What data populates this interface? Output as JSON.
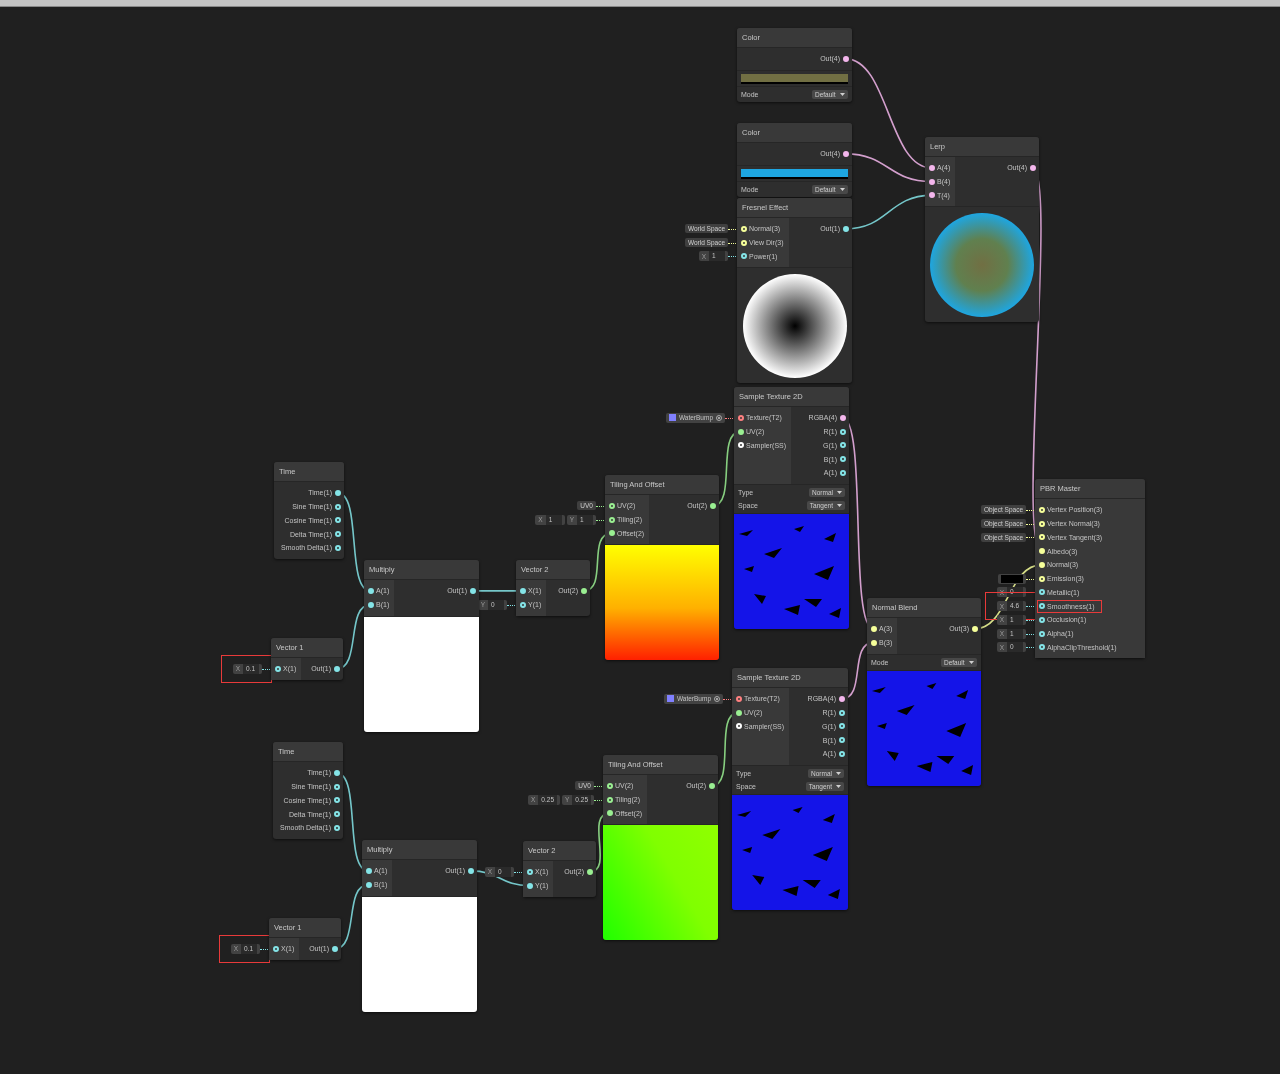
{
  "nodes": [
    {
      "title": "Time",
      "outputs": [
        {
          "label": "Time(1)",
          "color": "#84e4e7",
          "connected": true
        },
        {
          "label": "Sine Time(1)",
          "color": "#84e4e7",
          "connected": false
        },
        {
          "label": "Cosine Time(1)",
          "color": "#84e4e7",
          "connected": false
        },
        {
          "label": "Delta Time(1)",
          "color": "#84e4e7",
          "connected": false
        },
        {
          "label": "Smooth Delta(1)",
          "color": "#84e4e7",
          "connected": false
        }
      ]
    },
    {
      "title": "Vector 1",
      "inputs": [
        {
          "label": "X(1)",
          "color": "#84e4e7",
          "connected": false,
          "highlighted": true,
          "default": {
            "kind": "vector",
            "fields": [
              {
                "axis": "X",
                "value": "0.1"
              }
            ]
          }
        }
      ],
      "outputs": [
        {
          "label": "Out(1)",
          "color": "#84e4e7",
          "connected": true
        }
      ]
    },
    {
      "title": "Time",
      "outputs": [
        {
          "label": "Time(1)",
          "color": "#84e4e7",
          "connected": true
        },
        {
          "label": "Sine Time(1)",
          "color": "#84e4e7",
          "connected": false
        },
        {
          "label": "Cosine Time(1)",
          "color": "#84e4e7",
          "connected": false
        },
        {
          "label": "Delta Time(1)",
          "color": "#84e4e7",
          "connected": false
        },
        {
          "label": "Smooth Delta(1)",
          "color": "#84e4e7",
          "connected": false
        }
      ]
    },
    {
      "title": "Vector 1",
      "inputs": [
        {
          "label": "X(1)",
          "color": "#84e4e7",
          "connected": false,
          "highlighted": true,
          "default": {
            "kind": "vector",
            "fields": [
              {
                "axis": "X",
                "value": "0.1"
              }
            ]
          }
        }
      ],
      "outputs": [
        {
          "label": "Out(1)",
          "color": "#84e4e7",
          "connected": true
        }
      ]
    },
    {
      "title": "Multiply",
      "inputs": [
        {
          "label": "A(1)",
          "color": "#84e4e7",
          "connected": true
        },
        {
          "label": "B(1)",
          "color": "#84e4e7",
          "connected": true
        }
      ],
      "outputs": [
        {
          "label": "Out(1)",
          "color": "#84e4e7",
          "connected": true
        }
      ],
      "preview": {
        "kind": "flat"
      }
    },
    {
      "title": "Multiply",
      "inputs": [
        {
          "label": "A(1)",
          "color": "#84e4e7",
          "connected": true
        },
        {
          "label": "B(1)",
          "color": "#84e4e7",
          "connected": true
        }
      ],
      "outputs": [
        {
          "label": "Out(1)",
          "color": "#84e4e7",
          "connected": true
        }
      ],
      "preview": {
        "kind": "flat"
      }
    },
    {
      "title": "Vector 2",
      "inputs": [
        {
          "label": "X(1)",
          "color": "#84e4e7",
          "connected": true
        },
        {
          "label": "Y(1)",
          "color": "#84e4e7",
          "connected": false,
          "default": {
            "kind": "vector",
            "fields": [
              {
                "axis": "Y",
                "value": "0"
              }
            ]
          }
        }
      ],
      "outputs": [
        {
          "label": "Out(2)",
          "color": "#9aef92",
          "connected": true
        }
      ]
    },
    {
      "title": "Vector 2",
      "inputs": [
        {
          "label": "X(1)",
          "color": "#84e4e7",
          "connected": false,
          "default": {
            "kind": "vector",
            "fields": [
              {
                "axis": "X",
                "value": "0"
              }
            ]
          }
        },
        {
          "label": "Y(1)",
          "color": "#84e4e7",
          "connected": true
        }
      ],
      "outputs": [
        {
          "label": "Out(2)",
          "color": "#9aef92",
          "connected": true
        }
      ]
    },
    {
      "title": "Tiling And Offset",
      "inputs": [
        {
          "label": "UV(2)",
          "color": "#9aef92",
          "connected": false,
          "default": {
            "kind": "dropdown",
            "value": "UV0"
          }
        },
        {
          "label": "Tiling(2)",
          "color": "#9aef92",
          "connected": false,
          "default": {
            "kind": "vector",
            "fields": [
              {
                "axis": "X",
                "value": "1"
              },
              {
                "axis": "Y",
                "value": "1"
              }
            ]
          }
        },
        {
          "label": "Offset(2)",
          "color": "#9aef92",
          "connected": true
        }
      ],
      "outputs": [
        {
          "label": "Out(2)",
          "color": "#9aef92",
          "connected": true
        }
      ],
      "preview": {
        "kind": "warm"
      }
    },
    {
      "title": "Tiling And Offset",
      "inputs": [
        {
          "label": "UV(2)",
          "color": "#9aef92",
          "connected": false,
          "default": {
            "kind": "dropdown",
            "value": "UV0"
          }
        },
        {
          "label": "Tiling(2)",
          "color": "#9aef92",
          "connected": false,
          "default": {
            "kind": "vector",
            "fields": [
              {
                "axis": "X",
                "value": "0.25"
              },
              {
                "axis": "Y",
                "value": "0.25"
              }
            ]
          }
        },
        {
          "label": "Offset(2)",
          "color": "#9aef92",
          "connected": true
        }
      ],
      "outputs": [
        {
          "label": "Out(2)",
          "color": "#9aef92",
          "connected": true
        }
      ],
      "preview": {
        "kind": "green"
      }
    },
    {
      "title": "Color",
      "outputs": [
        {
          "label": "Out(4)",
          "color": "#f3b6ec",
          "connected": true
        }
      ],
      "color": "#716f43",
      "settings": [
        {
          "label": "Mode",
          "value": "Default"
        }
      ]
    },
    {
      "title": "Color",
      "outputs": [
        {
          "label": "Out(4)",
          "color": "#f3b6ec",
          "connected": true
        }
      ],
      "color": "#1ea6e1",
      "settings": [
        {
          "label": "Mode",
          "value": "Default"
        }
      ]
    },
    {
      "title": "Fresnel Effect",
      "inputs": [
        {
          "label": "Normal(3)",
          "color": "#f6ff9a",
          "connected": false,
          "default": {
            "kind": "dropdown",
            "value": "World Space"
          }
        },
        {
          "label": "View Dir(3)",
          "color": "#f6ff9a",
          "connected": false,
          "default": {
            "kind": "dropdown",
            "value": "World Space"
          }
        },
        {
          "label": "Power(1)",
          "color": "#84e4e7",
          "connected": false,
          "default": {
            "kind": "vector",
            "fields": [
              {
                "axis": "X",
                "value": "1"
              }
            ]
          }
        }
      ],
      "outputs": [
        {
          "label": "Out(1)",
          "color": "#84e4e7",
          "connected": true
        }
      ],
      "preview": {
        "kind": "fresnel"
      }
    },
    {
      "title": "Sample Texture 2D",
      "inputs": [
        {
          "label": "Texture(T2)",
          "color": "#ff8080",
          "connected": false,
          "default": {
            "kind": "texture",
            "value": "WaterBump"
          }
        },
        {
          "label": "UV(2)",
          "color": "#9aef92",
          "connected": true
        },
        {
          "label": "Sampler(SS)",
          "color": "#ffffff",
          "connected": false
        }
      ],
      "outputs": [
        {
          "label": "RGBA(4)",
          "color": "#f3b6ec",
          "connected": true
        },
        {
          "label": "R(1)",
          "color": "#84e4e7",
          "connected": false
        },
        {
          "label": "G(1)",
          "color": "#84e4e7",
          "connected": false
        },
        {
          "label": "B(1)",
          "color": "#84e4e7",
          "connected": false
        },
        {
          "label": "A(1)",
          "color": "#84e4e7",
          "connected": false
        }
      ],
      "settings": [
        {
          "label": "Type",
          "value": "Normal"
        },
        {
          "label": "Space",
          "value": "Tangent"
        }
      ],
      "preview": {
        "kind": "normal"
      }
    },
    {
      "title": "Sample Texture 2D",
      "inputs": [
        {
          "label": "Texture(T2)",
          "color": "#ff8080",
          "connected": false,
          "default": {
            "kind": "texture",
            "value": "WaterBump"
          }
        },
        {
          "label": "UV(2)",
          "color": "#9aef92",
          "connected": true
        },
        {
          "label": "Sampler(SS)",
          "color": "#ffffff",
          "connected": false
        }
      ],
      "outputs": [
        {
          "label": "RGBA(4)",
          "color": "#f3b6ec",
          "connected": true
        },
        {
          "label": "R(1)",
          "color": "#84e4e7",
          "connected": false
        },
        {
          "label": "G(1)",
          "color": "#84e4e7",
          "connected": false
        },
        {
          "label": "B(1)",
          "color": "#84e4e7",
          "connected": false
        },
        {
          "label": "A(1)",
          "color": "#84e4e7",
          "connected": false
        }
      ],
      "settings": [
        {
          "label": "Type",
          "value": "Normal"
        },
        {
          "label": "Space",
          "value": "Tangent"
        }
      ],
      "preview": {
        "kind": "normal"
      }
    },
    {
      "title": "Normal Blend",
      "inputs": [
        {
          "label": "A(3)",
          "color": "#f6ff9a",
          "connected": true
        },
        {
          "label": "B(3)",
          "color": "#f6ff9a",
          "connected": true
        }
      ],
      "outputs": [
        {
          "label": "Out(3)",
          "color": "#f6ff9a",
          "connected": true
        }
      ],
      "settings": [
        {
          "label": "Mode",
          "value": "Default"
        }
      ],
      "preview": {
        "kind": "normal"
      }
    },
    {
      "title": "Lerp",
      "inputs": [
        {
          "label": "A(4)",
          "color": "#f3b6ec",
          "connected": true
        },
        {
          "label": "B(4)",
          "color": "#f3b6ec",
          "connected": true
        },
        {
          "label": "T(4)",
          "color": "#f3b6ec",
          "connected": true
        }
      ],
      "outputs": [
        {
          "label": "Out(4)",
          "color": "#f3b6ec",
          "connected": true
        }
      ],
      "preview": {
        "kind": "lerp"
      }
    },
    {
      "title": "PBR Master",
      "inputs": [
        {
          "label": "Vertex Position(3)",
          "color": "#f6ff9a",
          "connected": false,
          "highlighted": false,
          "default": {
            "kind": "dropdown",
            "value": "Object Space"
          }
        },
        {
          "label": "Vertex Normal(3)",
          "color": "#f6ff9a",
          "connected": false,
          "highlighted": false,
          "default": {
            "kind": "dropdown",
            "value": "Object Space"
          }
        },
        {
          "label": "Vertex Tangent(3)",
          "color": "#f6ff9a",
          "connected": false,
          "highlighted": false,
          "default": {
            "kind": "dropdown",
            "value": "Object Space"
          }
        },
        {
          "label": "Albedo(3)",
          "color": "#f6ff9a",
          "connected": true,
          "highlighted": false
        },
        {
          "label": "Normal(3)",
          "color": "#f6ff9a",
          "connected": true,
          "highlighted": false
        },
        {
          "label": "Emission(3)",
          "color": "#f6ff9a",
          "connected": false,
          "highlighted": false,
          "default": {
            "kind": "color",
            "color": "#000000"
          }
        },
        {
          "label": "Metallic(1)",
          "color": "#84e4e7",
          "connected": false,
          "highlighted": false,
          "default": {
            "kind": "vector",
            "fields": [
              {
                "axis": "X",
                "value": "0"
              }
            ]
          }
        },
        {
          "label": "Smoothness(1)",
          "color": "#84e4e7",
          "connected": false,
          "highlighted": true,
          "default": {
            "kind": "vector",
            "fields": [
              {
                "axis": "X",
                "value": "4.6"
              }
            ]
          }
        },
        {
          "label": "Occlusion(1)",
          "color": "#84e4e7",
          "connected": false,
          "highlighted": false,
          "default": {
            "kind": "vector",
            "fields": [
              {
                "axis": "X",
                "value": "1"
              }
            ]
          }
        },
        {
          "label": "Alpha(1)",
          "color": "#84e4e7",
          "connected": false,
          "highlighted": false,
          "default": {
            "kind": "vector",
            "fields": [
              {
                "axis": "X",
                "value": "1"
              }
            ]
          }
        },
        {
          "label": "AlphaClipThreshold(1)",
          "color": "#84e4e7",
          "connected": false,
          "highlighted": false,
          "default": {
            "kind": "vector",
            "fields": [
              {
                "axis": "X",
                "value": "0"
              }
            ]
          }
        }
      ]
    }
  ]
}
